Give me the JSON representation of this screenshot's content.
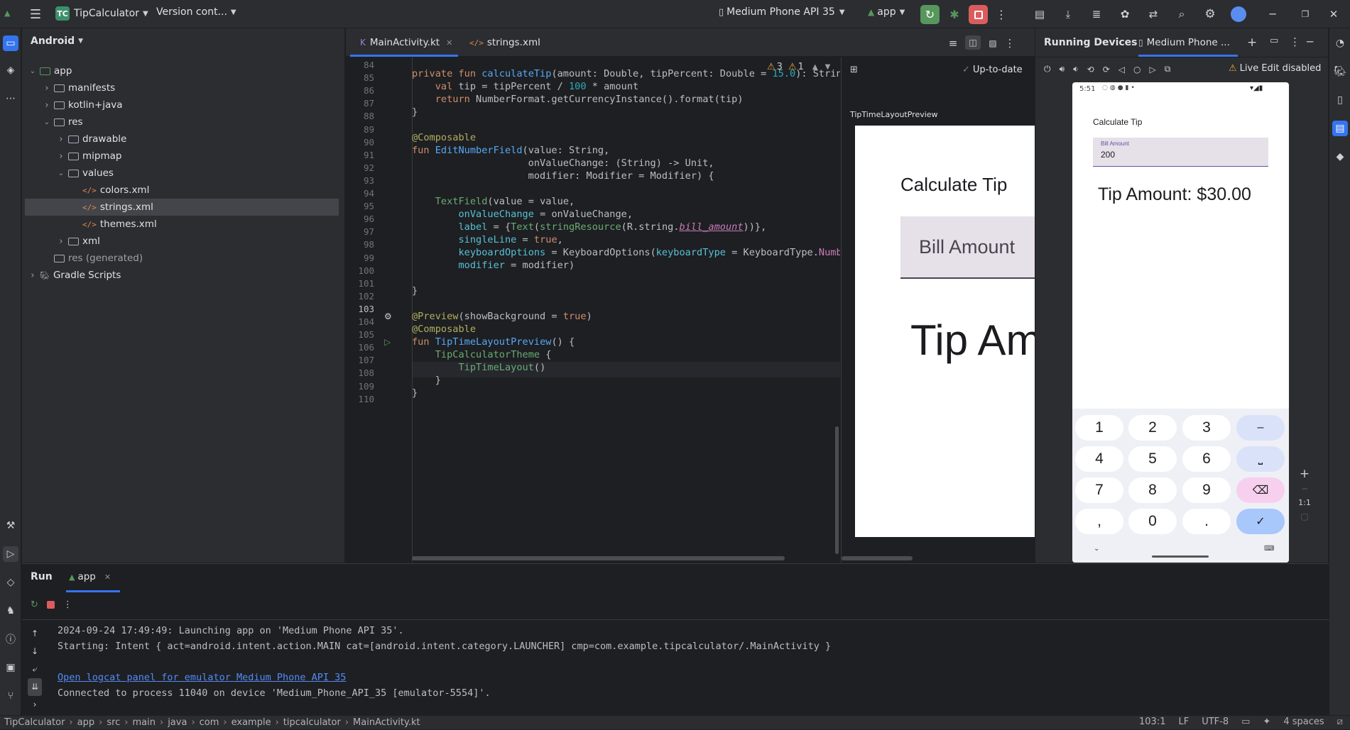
{
  "topbar": {
    "project_badge": "TC",
    "project_name": "TipCalculator",
    "vcs": "Version cont...",
    "device": "Medium Phone API 35",
    "run_config": "app"
  },
  "project_panel": {
    "view": "Android",
    "tree": [
      {
        "label": "app",
        "kind": "module",
        "depth": 0,
        "expanded": true
      },
      {
        "label": "manifests",
        "kind": "folder",
        "depth": 1,
        "expanded": false
      },
      {
        "label": "kotlin+java",
        "kind": "folder",
        "depth": 1,
        "expanded": false
      },
      {
        "label": "res",
        "kind": "folder",
        "depth": 1,
        "expanded": true
      },
      {
        "label": "drawable",
        "kind": "folder",
        "depth": 2,
        "expanded": false
      },
      {
        "label": "mipmap",
        "kind": "folder",
        "depth": 2,
        "expanded": false
      },
      {
        "label": "values",
        "kind": "folder",
        "depth": 2,
        "expanded": true
      },
      {
        "label": "colors.xml",
        "kind": "xml",
        "depth": 3
      },
      {
        "label": "strings.xml",
        "kind": "xml",
        "depth": 3,
        "selected": true
      },
      {
        "label": "themes.xml",
        "kind": "xml",
        "depth": 3
      },
      {
        "label": "xml",
        "kind": "folder",
        "depth": 2,
        "expanded": false
      },
      {
        "label": "res (generated)",
        "kind": "folder",
        "depth": 1
      },
      {
        "label": "Gradle Scripts",
        "kind": "gradle",
        "depth": 0,
        "expanded": false
      }
    ]
  },
  "editor": {
    "tabs": [
      {
        "label": "MainActivity.kt",
        "active": true
      },
      {
        "label": "strings.xml",
        "active": false
      }
    ],
    "warnings": "3",
    "weak_warnings": "1",
    "current_line": "103",
    "line_numbers": [
      "84",
      "85",
      "86",
      "87",
      "88",
      "89",
      "90",
      "91",
      "92",
      "93",
      "94",
      "95",
      "96",
      "97",
      "98",
      "99",
      "100",
      "101",
      "102",
      "103",
      "104",
      "105",
      "106",
      "107",
      "108",
      "109",
      "110"
    ]
  },
  "preview": {
    "status": "Up-to-date",
    "name": "TipTimeLayoutPreview",
    "title": "Calculate Tip",
    "field_label": "Bill Amount",
    "tip_text": "Tip Am"
  },
  "running_devices": {
    "title": "Running Devices",
    "device_tab": "Medium Phone ...",
    "live_edit": "Live Edit disabled",
    "zoom_label": "1:1",
    "phone": {
      "time": "5:51",
      "title": "Calculate Tip",
      "field_label": "Bill Amount",
      "field_value": "200",
      "tip_text": "Tip Amount: $30.00",
      "keys": [
        "1",
        "2",
        "3",
        "–",
        "4",
        "5",
        "6",
        "⎵",
        "7",
        "8",
        "9",
        "⌫",
        ",",
        "0",
        ".",
        "✓"
      ]
    }
  },
  "run_panel": {
    "title": "Run",
    "tab": "app",
    "lines": [
      "2024-09-24 17:49:49: Launching app on 'Medium Phone API 35'.",
      "Starting: Intent { act=android.intent.action.MAIN cat=[android.intent.category.LAUNCHER] cmp=com.example.tipcalculator/.MainActivity }",
      "",
      "Open logcat panel for emulator Medium Phone API 35",
      "Connected to process 11040 on device 'Medium_Phone_API_35 [emulator-5554]'."
    ]
  },
  "status_bar": {
    "breadcrumbs": [
      "TipCalculator",
      "app",
      "src",
      "main",
      "java",
      "com",
      "example",
      "tipcalculator",
      "MainActivity.kt"
    ],
    "position": "103:1",
    "line_sep": "LF",
    "encoding": "UTF-8",
    "indent": "4 spaces"
  },
  "colors": {
    "accent": "#3574f0",
    "run_green": "#57965c",
    "stop_red": "#db5c5c",
    "link": "#548af7"
  }
}
